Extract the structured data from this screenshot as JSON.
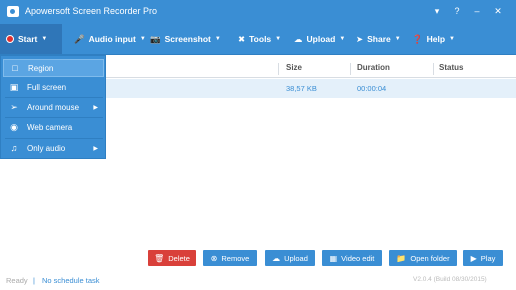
{
  "window": {
    "title": "Apowersoft Screen Recorder Pro"
  },
  "toolbar": {
    "start": "Start",
    "audio_input": "Audio input",
    "screenshot": "Screenshot",
    "tools": "Tools",
    "upload": "Upload",
    "share": "Share",
    "help": "Help"
  },
  "table": {
    "columns": [
      "Size",
      "Duration",
      "Status"
    ],
    "rows": [
      {
        "size": "38,57 KB",
        "duration": "00:00:04",
        "status": ""
      }
    ]
  },
  "start_menu": {
    "items": [
      {
        "label": "Region",
        "icon": "region-icon",
        "selected": true,
        "submenu": false
      },
      {
        "label": "Full screen",
        "icon": "monitor-icon",
        "selected": false,
        "submenu": false
      },
      {
        "label": "Around mouse",
        "icon": "mouse-icon",
        "selected": false,
        "submenu": true
      },
      {
        "label": "Web camera",
        "icon": "webcam-icon",
        "selected": false,
        "submenu": false
      },
      {
        "label": "Only audio",
        "icon": "music-note-icon",
        "selected": false,
        "submenu": true
      }
    ]
  },
  "actions": {
    "delete": "Delete",
    "remove": "Remove",
    "upload": "Upload",
    "video_edit": "Video edit",
    "open_folder": "Open folder",
    "play": "Play"
  },
  "status_bar": {
    "state": "Ready",
    "separator": "|",
    "schedule": "No schedule task",
    "version": "V2.0.4 (Build 08/30/2015)"
  },
  "colors": {
    "accent": "#3a8ed4",
    "danger": "#d9403a",
    "selection": "#e4f0fa",
    "record": "#e03030"
  }
}
